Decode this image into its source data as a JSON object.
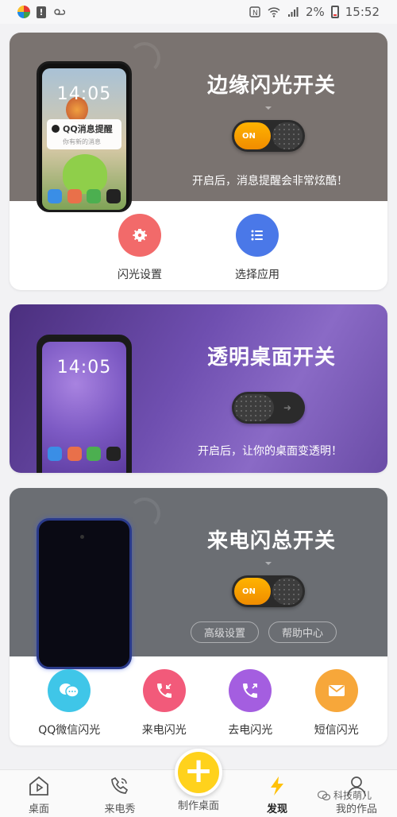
{
  "status_bar": {
    "time": "15:52",
    "battery": "2%"
  },
  "cards": {
    "edge_flash": {
      "title": "边缘闪光开关",
      "toggle_label": "ON",
      "description": "开启后，消息提醒会非常炫酷！",
      "phone_time": "14:05",
      "notification_title": "QQ消息提醒",
      "notification_body": "你有新的消息",
      "actions": [
        {
          "label": "闪光设置",
          "icon": "gear-icon",
          "color": "#f26a6a"
        },
        {
          "label": "选择应用",
          "icon": "list-icon",
          "color": "#4a78e8"
        }
      ]
    },
    "transparent_desktop": {
      "title": "透明桌面开关",
      "description": "开启后，让你的桌面变透明！",
      "phone_time": "14:05"
    },
    "incoming_call_flash": {
      "title": "来电闪总开关",
      "toggle_label": "ON",
      "advanced_settings": "高级设置",
      "help_center": "帮助中心",
      "actions": [
        {
          "label": "QQ微信闪光",
          "icon": "chat-bubbles-icon",
          "color": "#3fc6e8"
        },
        {
          "label": "来电闪光",
          "icon": "incoming-call-icon",
          "color": "#f25a7a"
        },
        {
          "label": "去电闪光",
          "icon": "outgoing-call-icon",
          "color": "#a45ee0"
        },
        {
          "label": "短信闪光",
          "icon": "envelope-icon",
          "color": "#f7a73a"
        }
      ]
    }
  },
  "bottom_nav": {
    "items": [
      {
        "label": "桌面",
        "icon": "desktop-play-icon"
      },
      {
        "label": "来电秀",
        "icon": "phone-icon"
      },
      {
        "label": "制作桌面",
        "icon": "plus-icon"
      },
      {
        "label": "发现",
        "icon": "lightning-icon"
      },
      {
        "label": "我的作品",
        "icon": "user-icon"
      }
    ]
  },
  "watermark": "科技萌儿",
  "colors": {
    "accent_yellow": "#ffd21c",
    "toggle_on": "#ffb300"
  }
}
